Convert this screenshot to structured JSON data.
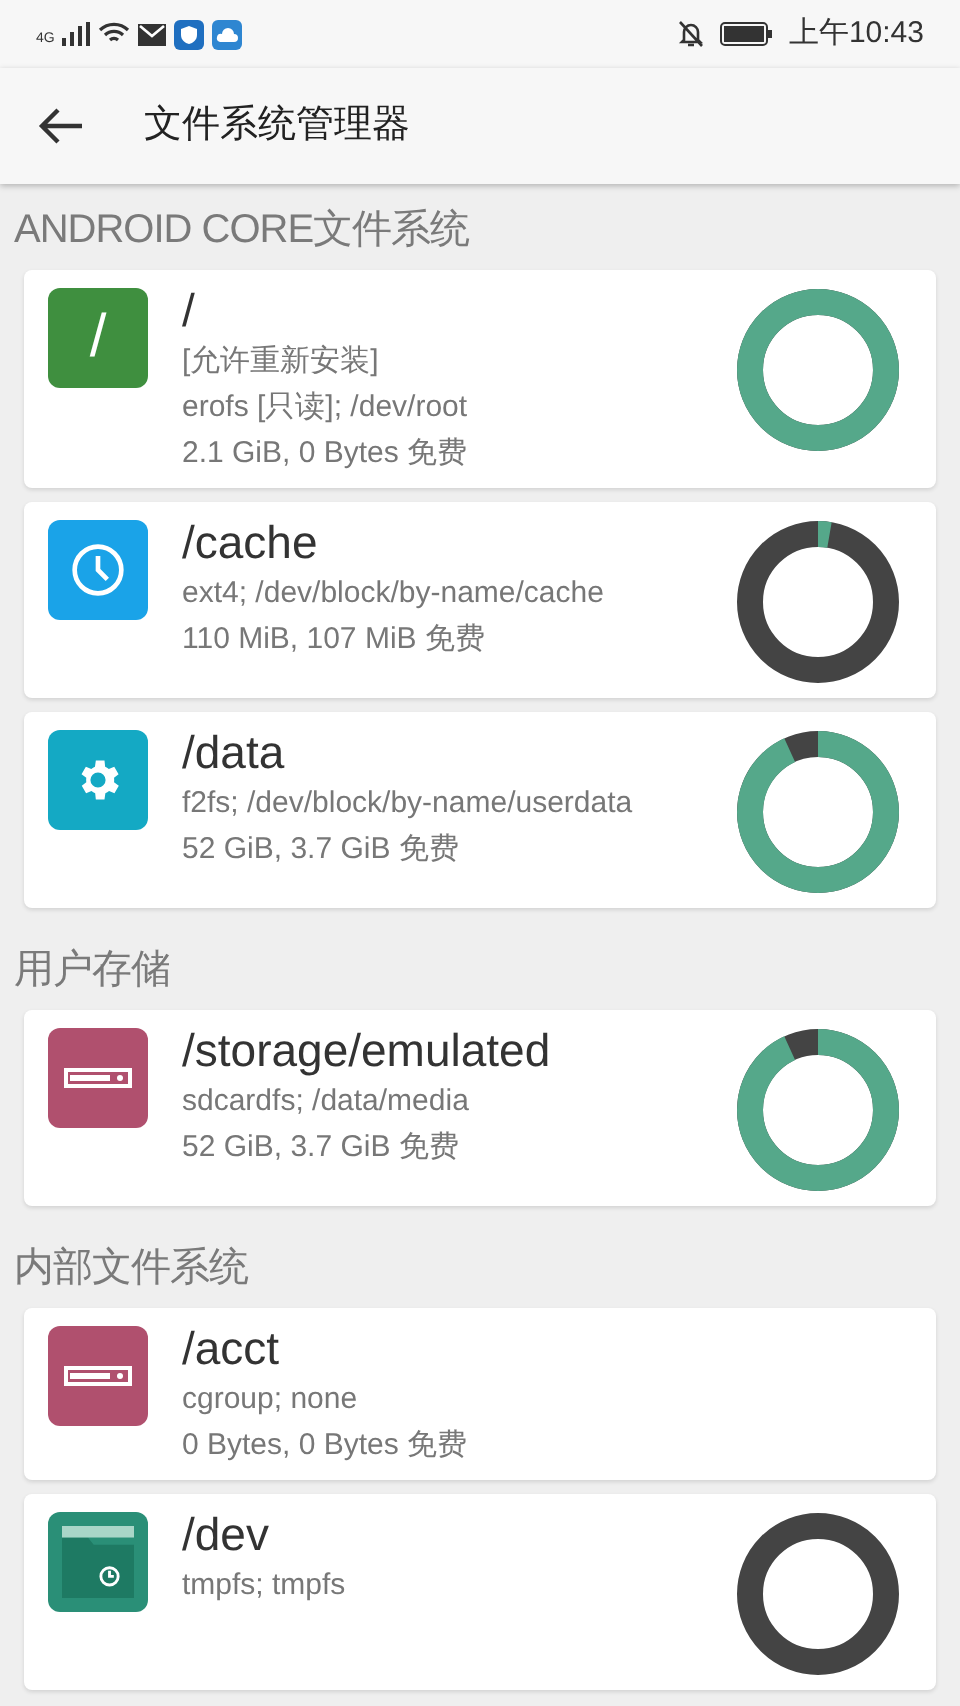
{
  "status_bar": {
    "network": "4G",
    "time": "上午10:43"
  },
  "toolbar": {
    "title": "文件系统管理器"
  },
  "sections": [
    {
      "title": "ANDROID CORE文件系统",
      "items": [
        {
          "kind": "root",
          "color": "#3f8f3f",
          "glyph": "/",
          "name": "/",
          "lines": [
            "[允许重新安装]",
            "erofs [只读]; /dev/root",
            "2.1 GiB, 0 Bytes 免费"
          ],
          "level": 1
        },
        {
          "kind": "clock",
          "color": "#1aa3e8",
          "name": "/cache",
          "lines": [
            "ext4; /dev/block/by-name/cache",
            "110 MiB, 107 MiB 免费"
          ],
          "level": 0.027
        },
        {
          "kind": "gear",
          "color": "#14a9c4",
          "name": "/data",
          "lines": [
            "f2fs; /dev/block/by-name/userdata",
            "52 GiB, 3.7 GiB 免费"
          ],
          "level": 0.93
        }
      ]
    },
    {
      "title": "用户存储",
      "items": [
        {
          "kind": "drive",
          "color": "#b0506e",
          "name": "/storage/emulated",
          "lines": [
            "sdcardfs; /data/media",
            "52 GiB, 3.7 GiB 免费"
          ],
          "level": 0.93
        }
      ]
    },
    {
      "title": "内部文件系统",
      "items": [
        {
          "kind": "drive",
          "color": "#b0506e",
          "name": "/acct",
          "lines": [
            "cgroup; none",
            "0 Bytes, 0 Bytes 免费"
          ]
        },
        {
          "kind": "folder-clock",
          "color": "#2a8f77",
          "name": "/dev",
          "lines": [
            "tmpfs; tmpfs"
          ],
          "level": 0
        }
      ]
    }
  ]
}
